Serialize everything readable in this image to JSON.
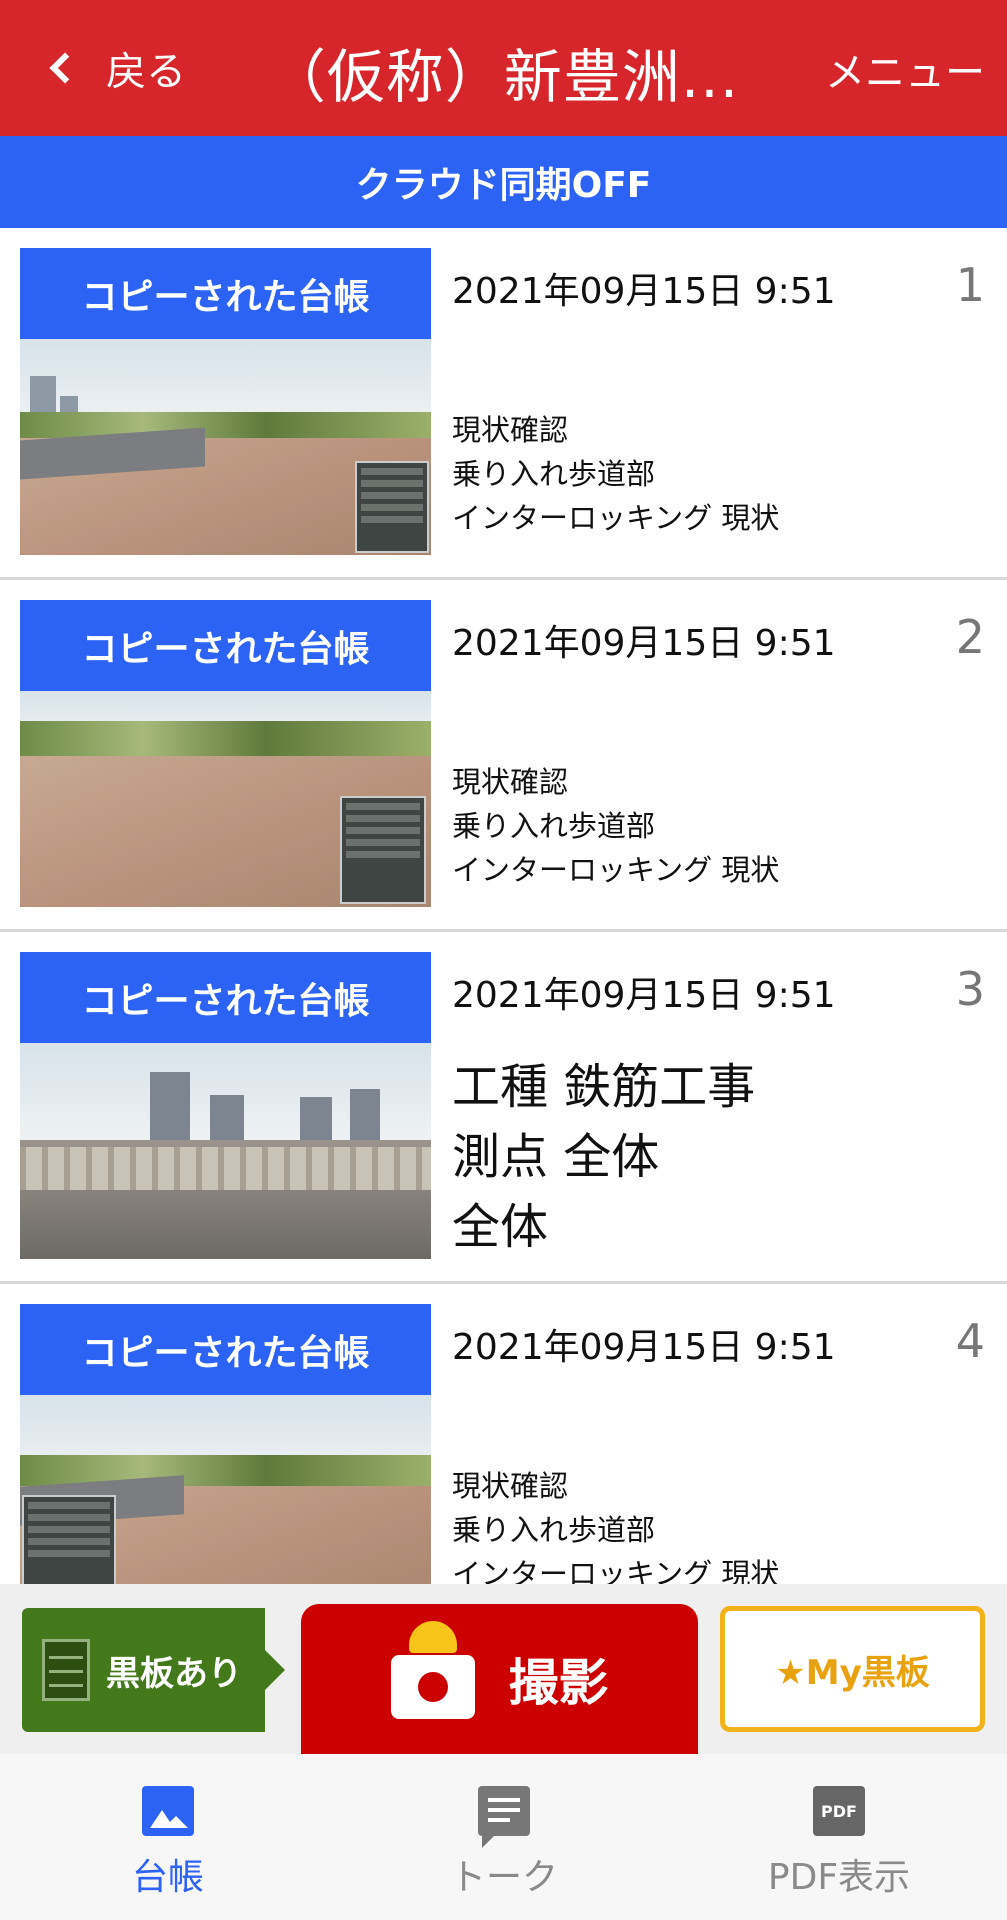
{
  "header": {
    "back_label": "戻る",
    "title": "（仮称）新豊洲...",
    "menu_label": "メニュー"
  },
  "sync_bar": {
    "label": "クラウド同期OFF"
  },
  "items": [
    {
      "copy_label": "コピーされた台帳",
      "date": "2021年09月15日 9:51",
      "number": "1",
      "lines": [
        "現状確認",
        "乗り入れ歩道部",
        "インターロッキング 現状"
      ]
    },
    {
      "copy_label": "コピーされた台帳",
      "date": "2021年09月15日 9:51",
      "number": "2",
      "lines": [
        "現状確認",
        "乗り入れ歩道部",
        "インターロッキング 現状"
      ]
    },
    {
      "copy_label": "コピーされた台帳",
      "date": "2021年09月15日 9:51",
      "number": "3",
      "lines": [
        "工種 鉄筋工事",
        "測点 全体",
        "全体"
      ]
    },
    {
      "copy_label": "コピーされた台帳",
      "date": "2021年09月15日 9:51",
      "number": "4",
      "lines": [
        "現状確認",
        "乗り入れ歩道部",
        "インターロッキング 現状"
      ]
    }
  ],
  "actions": {
    "board_toggle_label": "黒板あり",
    "shoot_label": "撮影",
    "my_board_label": "★My黒板"
  },
  "tabs": [
    {
      "label": "台帳",
      "icon": "image-icon",
      "active": true
    },
    {
      "label": "トーク",
      "icon": "chat-icon",
      "active": false
    },
    {
      "label": "PDF表示",
      "icon": "pdf-icon",
      "active": false,
      "icon_text": "PDF"
    }
  ],
  "colors": {
    "header": "#d7262b",
    "accent_blue": "#2d63f5",
    "shoot_red": "#cc0000",
    "board_green": "#43791b",
    "myboard_orange": "#f2b21a"
  }
}
